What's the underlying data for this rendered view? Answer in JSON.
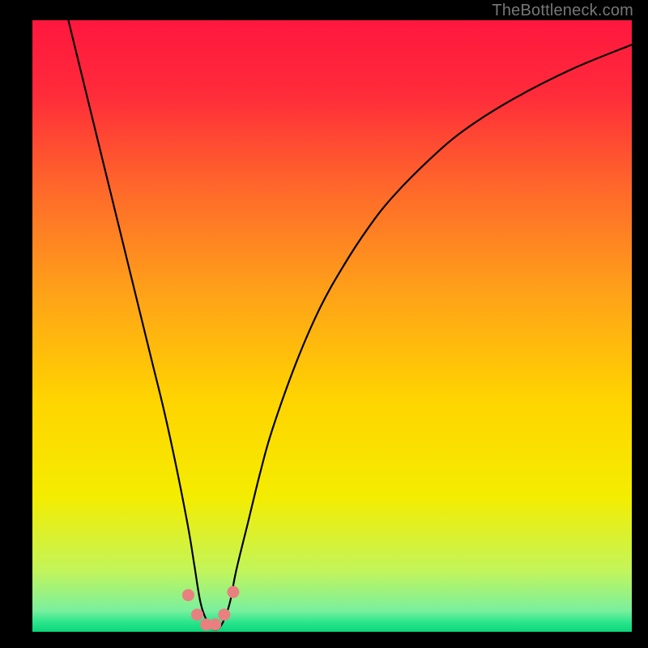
{
  "watermark": "TheBottleneck.com",
  "chart_data": {
    "type": "line",
    "title": "",
    "xlabel": "",
    "ylabel": "",
    "xlim": [
      0,
      100
    ],
    "ylim": [
      0,
      100
    ],
    "grid": false,
    "legend": false,
    "background_gradient_stops": [
      {
        "offset": 0.0,
        "color": "#ff173e"
      },
      {
        "offset": 0.12,
        "color": "#ff2b3a"
      },
      {
        "offset": 0.28,
        "color": "#ff6a2a"
      },
      {
        "offset": 0.45,
        "color": "#ffa318"
      },
      {
        "offset": 0.62,
        "color": "#ffd400"
      },
      {
        "offset": 0.78,
        "color": "#f4ed00"
      },
      {
        "offset": 0.9,
        "color": "#c3f55a"
      },
      {
        "offset": 0.965,
        "color": "#7af09e"
      },
      {
        "offset": 0.985,
        "color": "#29e58b"
      },
      {
        "offset": 1.0,
        "color": "#0bd67a"
      }
    ],
    "series": [
      {
        "name": "bottleneck-curve",
        "color": "#000000",
        "x": [
          6,
          8,
          10,
          12,
          14,
          16,
          18,
          20,
          22,
          24,
          26,
          27,
          28,
          29,
          30,
          31,
          32,
          33,
          34,
          36,
          38,
          40,
          44,
          48,
          52,
          56,
          60,
          66,
          72,
          80,
          90,
          100
        ],
        "y": [
          100,
          92,
          84,
          76,
          68,
          60,
          52,
          44,
          36,
          27,
          17,
          11,
          5,
          2,
          0.5,
          0.5,
          2,
          5,
          10,
          18,
          26,
          33,
          44,
          53,
          60,
          66,
          71,
          77,
          82,
          87,
          92,
          96
        ]
      }
    ],
    "markers": {
      "name": "highlight-dots",
      "color": "#e98080",
      "points": [
        {
          "x": 26.0,
          "y": 6.0
        },
        {
          "x": 27.5,
          "y": 2.8
        },
        {
          "x": 29.0,
          "y": 1.2
        },
        {
          "x": 30.5,
          "y": 1.2
        },
        {
          "x": 32.0,
          "y": 2.8
        },
        {
          "x": 33.5,
          "y": 6.5
        }
      ]
    }
  }
}
